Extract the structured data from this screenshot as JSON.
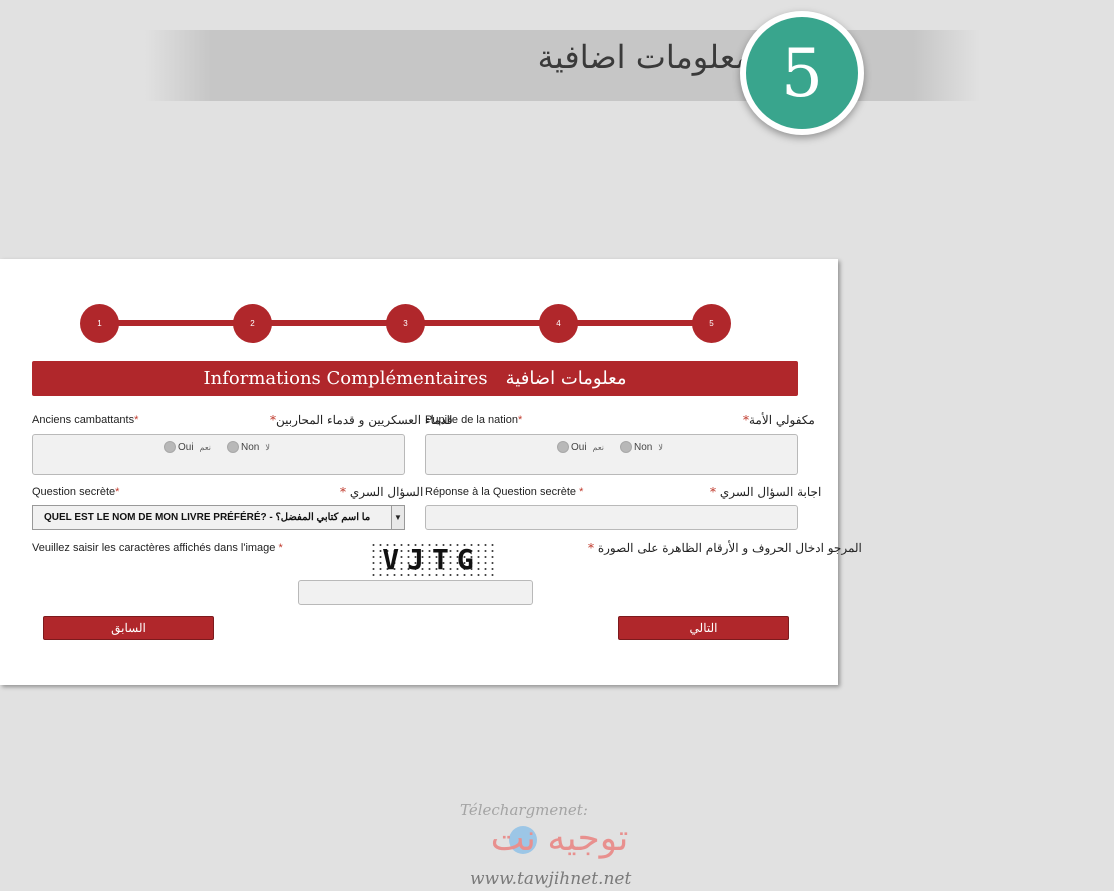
{
  "banner": {
    "title": "معلومات اضافية",
    "step_number": "5"
  },
  "colors": {
    "accent": "#b0272b",
    "step_circle": "#39a58d"
  },
  "stepper": {
    "steps": [
      "1",
      "2",
      "3",
      "4",
      "5"
    ]
  },
  "section": {
    "title_fr": "Informations Complémentaires",
    "title_ar": "معلومات اضافية"
  },
  "fields": {
    "anciens": {
      "label_fr": "Anciens cambattants",
      "label_ar": "قدماء العسكريين و قدماء المحاربين",
      "opt_oui": "Oui",
      "opt_oui_ar": "نعم",
      "opt_non": "Non",
      "opt_non_ar": "لا"
    },
    "pupille": {
      "label_fr": "Pupille de la nation",
      "label_ar": "مكفولي الأمة",
      "opt_oui": "Oui",
      "opt_oui_ar": "نعم",
      "opt_non": "Non",
      "opt_non_ar": "لا"
    },
    "question": {
      "label_fr": "Question secrète",
      "label_ar": "السؤال السري",
      "selected": "QUEL EST LE NOM DE MON LIVRE PRÉFÉRÉ? - ما اسم كتابي المفضل؟",
      "arrow": "▼"
    },
    "reponse": {
      "label_fr": "Réponse à la Question secrète",
      "label_ar": "اجابة السؤال السري",
      "value": ""
    },
    "captcha": {
      "label_fr": "Veuillez saisir les caractères affichés dans l'image",
      "label_ar": "المرجو ادخال الحروف و الأرقام الظاهرة على الصورة",
      "image_text": "VJTG",
      "value": ""
    },
    "required_mark": "*"
  },
  "buttons": {
    "previous": "السابق",
    "next": "التالي"
  },
  "watermark": {
    "top": "Télechargmenet:",
    "logo": "توجيه نت",
    "url": "www.tawjihnet.net"
  }
}
